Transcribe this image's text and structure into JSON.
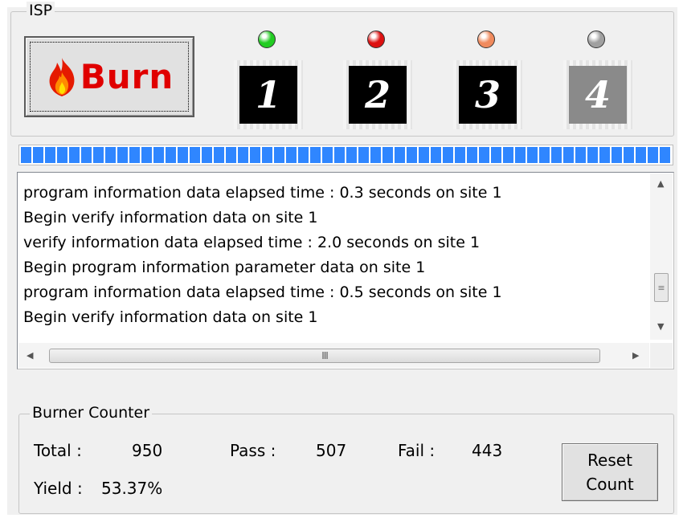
{
  "isp": {
    "title": "ISP",
    "burn_label": "Burn",
    "sites": [
      {
        "number": "1",
        "led_color": "#22cc22",
        "chip_color": "#000000"
      },
      {
        "number": "2",
        "led_color": "#dd1111",
        "chip_color": "#000000"
      },
      {
        "number": "3",
        "led_color": "#f08a5d",
        "chip_color": "#000000"
      },
      {
        "number": "4",
        "led_color": "#a0a0a0",
        "chip_color": "#8a8a8a"
      }
    ]
  },
  "progress": {
    "fraction": 1.0,
    "color": "#2f86ff"
  },
  "log": {
    "lines": [
      "program information data elapsed time : 0.3 seconds on site 1",
      "Begin verify information data on site 1",
      "verify information data elapsed time : 2.0 seconds on site 1",
      "Begin program information parameter data on site 1",
      "program information data elapsed time : 0.5 seconds on site 1",
      "Begin verify information data on site 1"
    ]
  },
  "counter": {
    "title": "Burner Counter",
    "total_label": "Total :",
    "total_value": "950",
    "pass_label": "Pass :",
    "pass_value": "507",
    "fail_label": "Fail :",
    "fail_value": "443",
    "yield_label": "Yield :",
    "yield_value": "53.37%",
    "reset_line1": "Reset",
    "reset_line2": "Count"
  },
  "icons": {
    "burn": "flame-icon",
    "site": "chip-icon",
    "status": "led-indicator-icon"
  }
}
